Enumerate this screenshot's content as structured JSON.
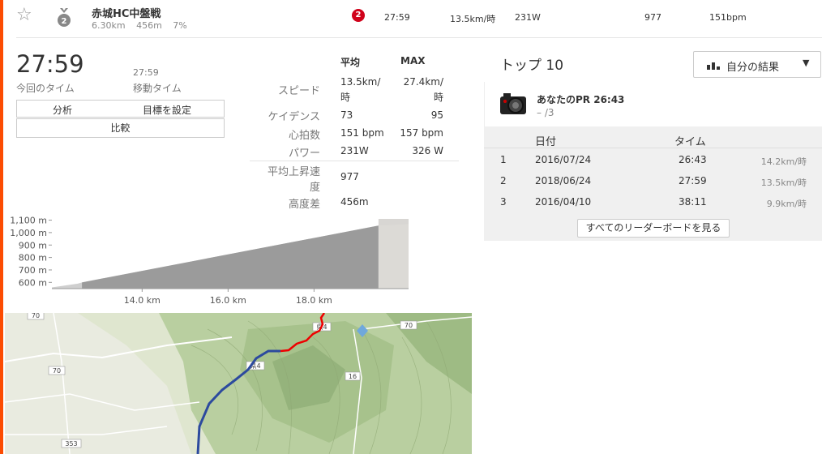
{
  "segment": {
    "name": "赤城HC中盤戦",
    "distance": "6.30km",
    "elevation": "456m",
    "grade": "7%",
    "medal_rank": "2",
    "rank_badge": "2",
    "time": "27:59",
    "speed": "13.5km/時",
    "power": "231W",
    "vam": "977",
    "heartrate": "151bpm"
  },
  "summary": {
    "elapsed_time": "27:59",
    "elapsed_label": "今回のタイム",
    "moving_time": "27:59",
    "moving_label": "移動タイム",
    "analyze_label": "分析",
    "goal_label": "目標を設定",
    "compare_label": "比較"
  },
  "stats": {
    "col_avg": "平均",
    "col_max": "MAX",
    "speed_label": "スピード",
    "speed_avg_1": "13.5km/",
    "speed_avg_2": "時",
    "speed_max_1": "27.4km/",
    "speed_max_2": "時",
    "cadence_label": "ケイデンス",
    "cadence_avg": "73",
    "cadence_max": "95",
    "hr_label": "心拍数",
    "hr_avg": "151 bpm",
    "hr_max": "157 bpm",
    "power_label": "パワー",
    "power_avg": "231W",
    "power_max": "326 W",
    "vam_label_1": "平均上昇速",
    "vam_label_2": "度",
    "vam_value": "977",
    "elev_label": "高度差",
    "elev_value": "456m"
  },
  "chart_data": {
    "type": "area",
    "title": "",
    "xlabel": "",
    "ylabel": "",
    "y_ticks": [
      "1,100 m",
      "1,000 m",
      "900 m",
      "800 m",
      "700 m",
      "600 m"
    ],
    "x_ticks": [
      "14.0 km",
      "16.0 km",
      "18.0 km"
    ],
    "ylim": [
      550,
      1110
    ],
    "xlim": [
      11.9,
      20.2
    ],
    "series": [
      {
        "x": [
          11.9,
          12.5,
          12.6,
          19.5
        ],
        "y": [
          560,
          590,
          600,
          1056
        ]
      }
    ],
    "segment_range": [
      12.6,
      19.5
    ]
  },
  "map": {
    "road_labels": [
      "70",
      "70",
      "70",
      "353",
      "16",
      "県4",
      "県4"
    ]
  },
  "leaderboard": {
    "title": "トップ 10",
    "dropdown_label": "自分の結果",
    "pr_label": "あなたのPR 26:43",
    "pr_rank": "– /3",
    "col_date": "日付",
    "col_time": "タイム",
    "rows": [
      {
        "rank": "1",
        "date": "2016/07/24",
        "time": "26:43",
        "speed": "14.2km/時"
      },
      {
        "rank": "2",
        "date": "2018/06/24",
        "time": "27:59",
        "speed": "13.5km/時"
      },
      {
        "rank": "3",
        "date": "2016/04/10",
        "time": "38:11",
        "speed": "9.9km/時"
      }
    ],
    "view_all_label": "すべてのリーダーボードを見る"
  }
}
